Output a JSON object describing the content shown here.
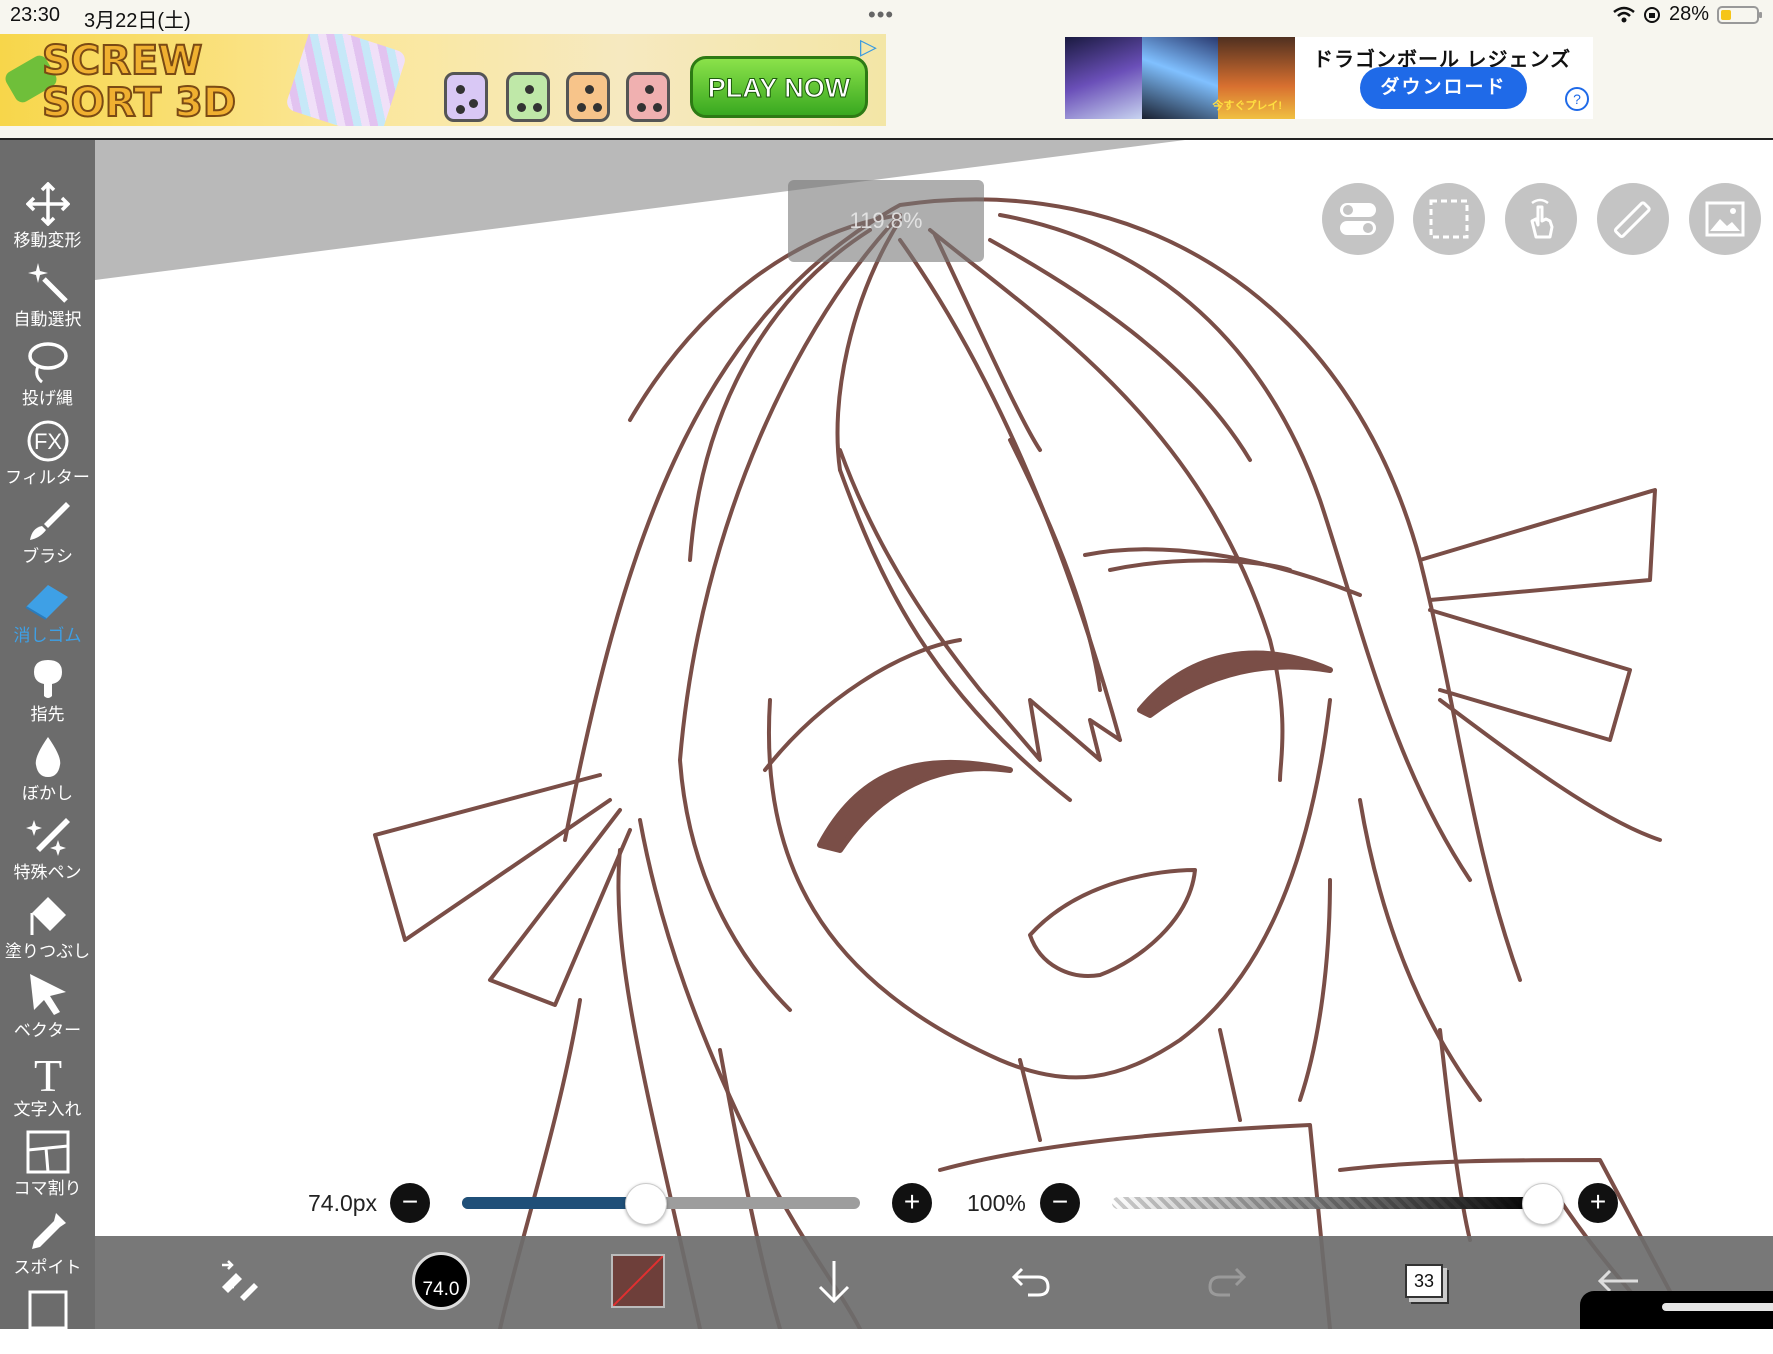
{
  "status": {
    "time": "23:30",
    "date": "3月22日(土)",
    "menu_dots": "•••",
    "battery": "28%",
    "battery_level": 0.28,
    "icons": [
      "wifi-icon",
      "location-lock-icon",
      "battery-icon"
    ]
  },
  "ads": {
    "left": {
      "title": "SCREW SORT 3D",
      "cta": "PLAY NOW",
      "ad_choices_icon": "ad-choices-icon"
    },
    "right": {
      "headline": "ドラゴンボール レジェンズ",
      "banner_text": "今すぐプレイ!",
      "button": "ダウンロード",
      "help": "?"
    }
  },
  "toolbar": {
    "tools": [
      {
        "label": "移動変形",
        "icon": "move-transform-icon",
        "active": false
      },
      {
        "label": "自動選択",
        "icon": "magic-wand-icon",
        "active": false
      },
      {
        "label": "投げ縄",
        "icon": "lasso-icon",
        "active": false
      },
      {
        "label": "フィルター",
        "icon": "fx-icon",
        "active": false
      },
      {
        "label": "ブラシ",
        "icon": "brush-icon",
        "active": false
      },
      {
        "label": "消しゴム",
        "icon": "eraser-icon",
        "active": true
      },
      {
        "label": "指先",
        "icon": "finger-smudge-icon",
        "active": false
      },
      {
        "label": "ぼかし",
        "icon": "blur-drop-icon",
        "active": false
      },
      {
        "label": "特殊ペン",
        "icon": "special-pen-icon",
        "active": false
      },
      {
        "label": "塗りつぶし",
        "icon": "fill-bucket-icon",
        "active": false
      },
      {
        "label": "ベクター",
        "icon": "vector-arrow-icon",
        "active": false
      },
      {
        "label": "文字入れ",
        "icon": "text-tool-icon",
        "active": false
      },
      {
        "label": "コマ割り",
        "icon": "panel-divide-icon",
        "active": false
      },
      {
        "label": "スポイト",
        "icon": "eyedropper-icon",
        "active": false
      },
      {
        "label": "",
        "icon": "canvas-frame-icon",
        "active": false
      }
    ]
  },
  "canvas": {
    "zoom": "119.8%",
    "line_color": "#7a4e47",
    "quick_buttons": [
      "toggle-icon",
      "selection-rect-icon",
      "touch-gesture-icon",
      "ruler-icon",
      "image-icon"
    ]
  },
  "brush": {
    "size_label": "74.0px",
    "size_level": 0.46,
    "opacity_label": "100%",
    "opacity_level": 1.0,
    "minus": "−",
    "plus": "+"
  },
  "bottom": {
    "brush_size_badge": "74.0",
    "color": "#6e3f3a",
    "layer_count": "33"
  },
  "colors": {
    "toolbar_bg": "#6c6c6c",
    "active_tool": "#3ea0e6",
    "slider_fill": "#1f4f78"
  }
}
